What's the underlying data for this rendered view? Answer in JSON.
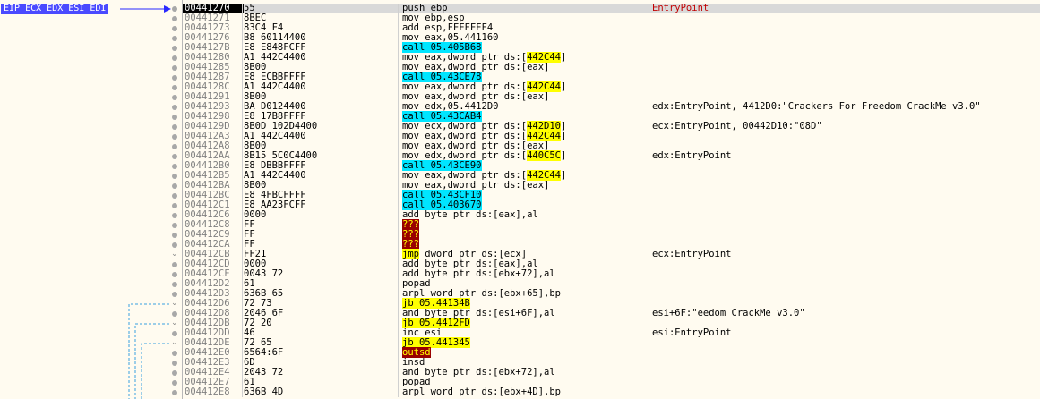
{
  "eip_label": "EIP ECX EDX ESI EDI",
  "rows": [
    {
      "addr": "00441270",
      "bytes": "55",
      "instr": [
        {
          "t": "push ebp"
        }
      ],
      "comment": "EntryPoint",
      "current": true,
      "marker": "dot"
    },
    {
      "addr": "00441271",
      "bytes": "8BEC",
      "instr": [
        {
          "t": "mov ebp,esp"
        }
      ],
      "comment": "",
      "marker": "dot"
    },
    {
      "addr": "00441273",
      "bytes": "83C4 F4",
      "instr": [
        {
          "t": "add esp,FFFFFFF4"
        }
      ],
      "comment": "",
      "marker": "dot"
    },
    {
      "addr": "00441276",
      "bytes": "B8 60114400",
      "instr": [
        {
          "t": "mov eax,05.441160"
        }
      ],
      "comment": "",
      "marker": "dot"
    },
    {
      "addr": "0044127B",
      "bytes": "E8 E848FCFF",
      "instr": [
        {
          "t": "call 05.405B68",
          "hl": "call"
        }
      ],
      "comment": "",
      "marker": "dot"
    },
    {
      "addr": "00441280",
      "bytes": "A1 442C4400",
      "instr": [
        {
          "t": "mov eax,dword ptr ds:["
        },
        {
          "t": "442C44",
          "hl": "mem"
        },
        {
          "t": "]"
        }
      ],
      "comment": "",
      "marker": "dot"
    },
    {
      "addr": "00441285",
      "bytes": "8B00",
      "instr": [
        {
          "t": "mov eax,dword ptr ds:[eax]"
        }
      ],
      "comment": "",
      "marker": "dot"
    },
    {
      "addr": "00441287",
      "bytes": "E8 ECBBFFFF",
      "instr": [
        {
          "t": "call 05.43CE78",
          "hl": "call"
        }
      ],
      "comment": "",
      "marker": "dot"
    },
    {
      "addr": "0044128C",
      "bytes": "A1 442C4400",
      "instr": [
        {
          "t": "mov eax,dword ptr ds:["
        },
        {
          "t": "442C44",
          "hl": "mem"
        },
        {
          "t": "]"
        }
      ],
      "comment": "",
      "marker": "dot"
    },
    {
      "addr": "00441291",
      "bytes": "8B00",
      "instr": [
        {
          "t": "mov eax,dword ptr ds:[eax]"
        }
      ],
      "comment": "",
      "marker": "dot"
    },
    {
      "addr": "00441293",
      "bytes": "BA D0124400",
      "instr": [
        {
          "t": "mov edx,05.4412D0"
        }
      ],
      "comment": "edx:EntryPoint, 4412D0:\"Crackers For Freedom CrackMe v3.0\"",
      "marker": "dot"
    },
    {
      "addr": "00441298",
      "bytes": "E8 17B8FFFF",
      "instr": [
        {
          "t": "call 05.43CAB4",
          "hl": "call"
        }
      ],
      "comment": "",
      "marker": "dot"
    },
    {
      "addr": "0044129D",
      "bytes": "8B0D 102D4400",
      "instr": [
        {
          "t": "mov ecx,dword ptr ds:["
        },
        {
          "t": "442D10",
          "hl": "mem"
        },
        {
          "t": "]"
        }
      ],
      "comment": "ecx:EntryPoint, 00442D10:\"08D\"",
      "marker": "dot"
    },
    {
      "addr": "004412A3",
      "bytes": "A1 442C4400",
      "instr": [
        {
          "t": "mov eax,dword ptr ds:["
        },
        {
          "t": "442C44",
          "hl": "mem"
        },
        {
          "t": "]"
        }
      ],
      "comment": "",
      "marker": "dot"
    },
    {
      "addr": "004412A8",
      "bytes": "8B00",
      "instr": [
        {
          "t": "mov eax,dword ptr ds:[eax]"
        }
      ],
      "comment": "",
      "marker": "dot"
    },
    {
      "addr": "004412AA",
      "bytes": "8B15 5C0C4400",
      "instr": [
        {
          "t": "mov edx,dword ptr ds:["
        },
        {
          "t": "440C5C",
          "hl": "mem"
        },
        {
          "t": "]"
        }
      ],
      "comment": "edx:EntryPoint",
      "marker": "dot"
    },
    {
      "addr": "004412B0",
      "bytes": "E8 DBBBFFFF",
      "instr": [
        {
          "t": "call 05.43CE90",
          "hl": "call"
        }
      ],
      "comment": "",
      "marker": "dot"
    },
    {
      "addr": "004412B5",
      "bytes": "A1 442C4400",
      "instr": [
        {
          "t": "mov eax,dword ptr ds:["
        },
        {
          "t": "442C44",
          "hl": "mem"
        },
        {
          "t": "]"
        }
      ],
      "comment": "",
      "marker": "dot"
    },
    {
      "addr": "004412BA",
      "bytes": "8B00",
      "instr": [
        {
          "t": "mov eax,dword ptr ds:[eax]"
        }
      ],
      "comment": "",
      "marker": "dot"
    },
    {
      "addr": "004412BC",
      "bytes": "E8 4FBCFFFF",
      "instr": [
        {
          "t": "call 05.43CF10",
          "hl": "call"
        }
      ],
      "comment": "",
      "marker": "dot"
    },
    {
      "addr": "004412C1",
      "bytes": "E8 AA23FCFF",
      "instr": [
        {
          "t": "call 05.403670",
          "hl": "call"
        }
      ],
      "comment": "",
      "marker": "dot"
    },
    {
      "addr": "004412C6",
      "bytes": "0000",
      "instr": [
        {
          "t": "add byte ptr ds:[eax],al"
        }
      ],
      "comment": "",
      "marker": "dot"
    },
    {
      "addr": "004412C8",
      "bytes": "FF",
      "instr": [
        {
          "t": "???",
          "hl": "bad"
        }
      ],
      "comment": "",
      "marker": "dot"
    },
    {
      "addr": "004412C9",
      "bytes": "FF",
      "instr": [
        {
          "t": "???",
          "hl": "bad"
        }
      ],
      "comment": "",
      "marker": "dot"
    },
    {
      "addr": "004412CA",
      "bytes": "FF",
      "instr": [
        {
          "t": "???",
          "hl": "bad"
        }
      ],
      "comment": "",
      "marker": "dot"
    },
    {
      "addr": "004412CB",
      "bytes": "FF21",
      "instr": [
        {
          "t": "jmp",
          "hl": "jmp"
        },
        {
          "t": " dword ptr ds:[ecx]"
        }
      ],
      "comment": "ecx:EntryPoint",
      "marker": "arrow"
    },
    {
      "addr": "004412CD",
      "bytes": "0000",
      "instr": [
        {
          "t": "add byte ptr ds:[eax],al"
        }
      ],
      "comment": "",
      "marker": "dot"
    },
    {
      "addr": "004412CF",
      "bytes": "0043 72",
      "instr": [
        {
          "t": "add byte ptr ds:[ebx+72],al"
        }
      ],
      "comment": "",
      "marker": "dot"
    },
    {
      "addr": "004412D2",
      "bytes": "61",
      "instr": [
        {
          "t": "popad"
        }
      ],
      "comment": "",
      "marker": "dot"
    },
    {
      "addr": "004412D3",
      "bytes": "636B 65",
      "instr": [
        {
          "t": "arpl word ptr ds:[ebx+65],bp"
        }
      ],
      "comment": "",
      "marker": "dot"
    },
    {
      "addr": "004412D6",
      "bytes": "72 73",
      "instr": [
        {
          "t": "jb 05.44134B",
          "hl": "jmp"
        }
      ],
      "comment": "",
      "marker": "arrow"
    },
    {
      "addr": "004412D8",
      "bytes": "2046 6F",
      "instr": [
        {
          "t": "and byte ptr ds:[esi+6F],al"
        }
      ],
      "comment": "esi+6F:\"eedom CrackMe v3.0\"",
      "marker": "dot"
    },
    {
      "addr": "004412DB",
      "bytes": "72 20",
      "instr": [
        {
          "t": "jb 05.4412FD",
          "hl": "jmp"
        }
      ],
      "comment": "",
      "marker": "arrow"
    },
    {
      "addr": "004412DD",
      "bytes": "46",
      "instr": [
        {
          "t": "inc esi"
        }
      ],
      "comment": "esi:EntryPoint",
      "marker": "dot"
    },
    {
      "addr": "004412DE",
      "bytes": "72 65",
      "instr": [
        {
          "t": "jb 05.441345",
          "hl": "jmp"
        }
      ],
      "comment": "",
      "marker": "arrow"
    },
    {
      "addr": "004412E0",
      "bytes": "6564:6F",
      "instr": [
        {
          "t": "outsd",
          "hl": "bad"
        }
      ],
      "comment": "",
      "marker": "dot"
    },
    {
      "addr": "004412E3",
      "bytes": "6D",
      "instr": [
        {
          "t": "insd"
        }
      ],
      "comment": "",
      "marker": "dot"
    },
    {
      "addr": "004412E4",
      "bytes": "2043 72",
      "instr": [
        {
          "t": "and byte ptr ds:[ebx+72],al"
        }
      ],
      "comment": "",
      "marker": "dot"
    },
    {
      "addr": "004412E7",
      "bytes": "61",
      "instr": [
        {
          "t": "popad"
        }
      ],
      "comment": "",
      "marker": "dot"
    },
    {
      "addr": "004412E8",
      "bytes": "636B 4D",
      "instr": [
        {
          "t": "arpl word ptr ds:[ebx+4D],bp"
        }
      ],
      "comment": "",
      "marker": "dot"
    }
  ]
}
